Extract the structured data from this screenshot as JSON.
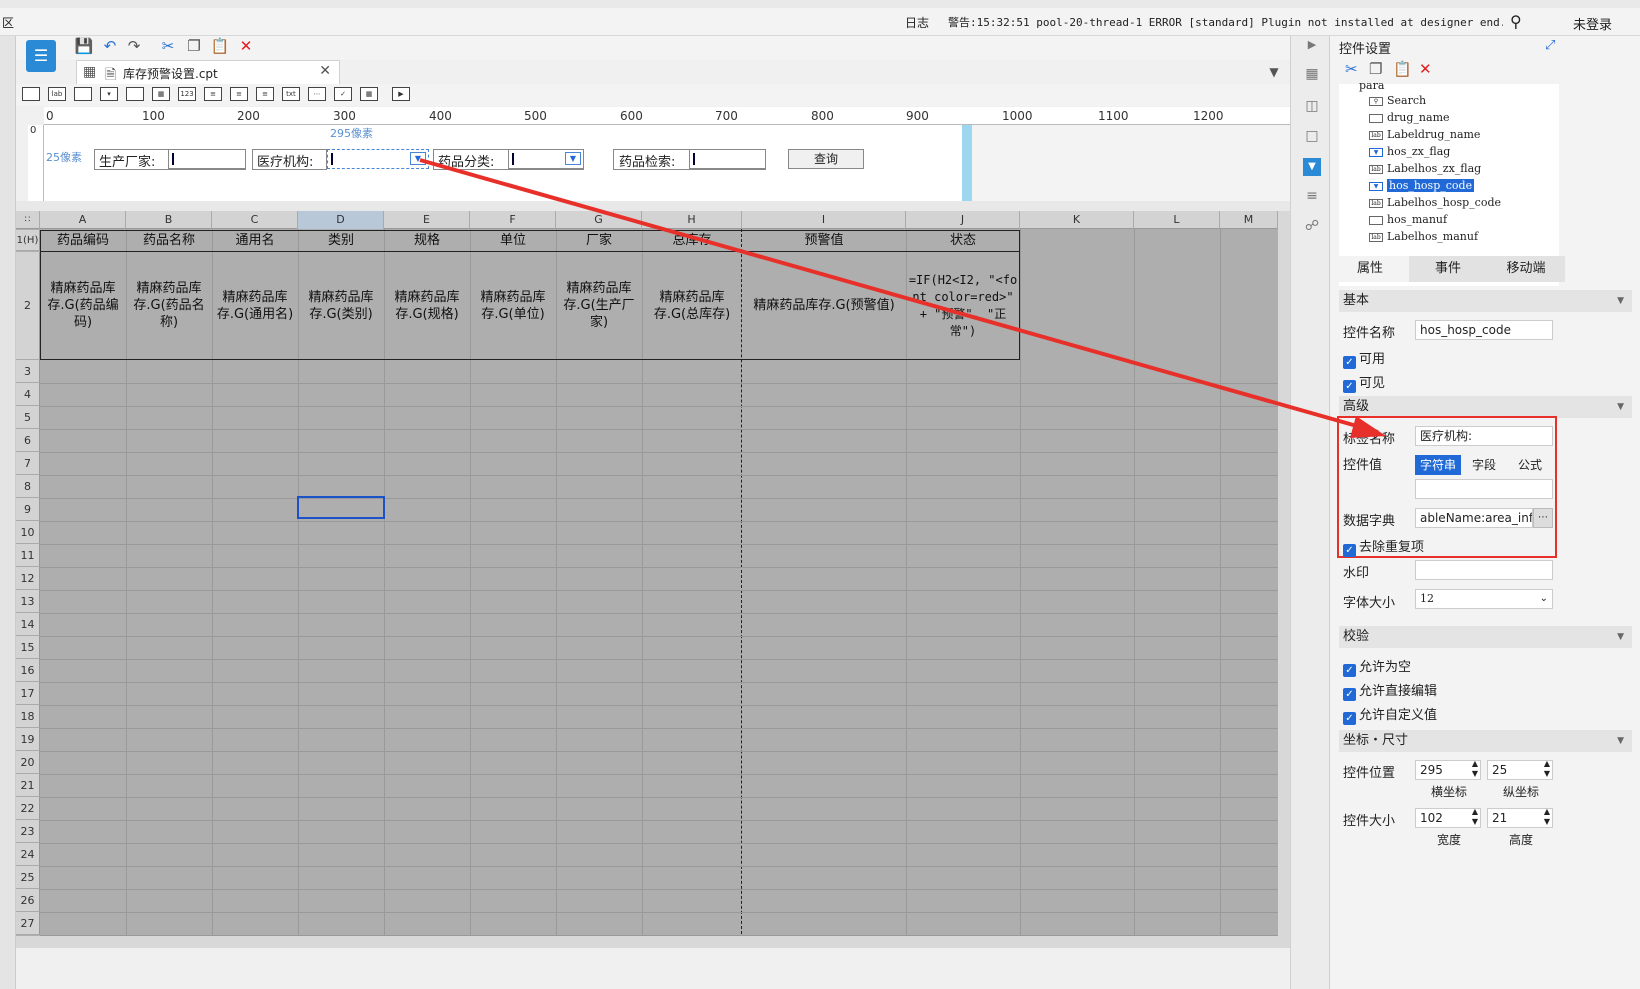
{
  "window": {
    "title_fragment": "区",
    "log_label": "日志",
    "warning": "警告:15:32:51 pool-20-thread-1 ERROR [standard] Plugin not installed at designer end.Plugi...",
    "login": "未登录"
  },
  "tab": {
    "label": "库存预警设置.cpt"
  },
  "ruler": {
    "ticks": [
      "0",
      "100",
      "200",
      "300",
      "400",
      "500",
      "600",
      "700",
      "800",
      "900",
      "1000",
      "1100",
      "1200"
    ],
    "vtick": "0"
  },
  "param": {
    "hint_x": "295像素",
    "hint_y": "25像素",
    "manufacturer_label": "生产厂家:",
    "hospital_label": "医疗机构:",
    "category_label": "药品分类:",
    "search_label": "药品检索:",
    "query_button": "查询"
  },
  "grid": {
    "columns": [
      "A",
      "B",
      "C",
      "D",
      "E",
      "F",
      "G",
      "H",
      "I",
      "J",
      "K",
      "L",
      "M"
    ],
    "row1_label": "1(H)",
    "headers": [
      "药品编码",
      "药品名称",
      "通用名",
      "类别",
      "规格",
      "单位",
      "厂家",
      "总库存",
      "预警值",
      "状态"
    ],
    "row2": [
      "精麻药品库存.G(药品编码)",
      "精麻药品库存.G(药品名称)",
      "精麻药品库存.G(通用名)",
      "精麻药品库存.G(类别)",
      "精麻药品库存.G(规格)",
      "精麻药品库存.G(单位)",
      "精麻药品库存.G(生产厂家)",
      "精麻药品库存.G(总库存)",
      "精麻药品库存.G(预警值)",
      "=IF(H2<I2, \"<font color=red>\" + \"预警\", \"正常\")"
    ],
    "row_numbers": [
      "2",
      "3",
      "4",
      "5",
      "6",
      "7",
      "8",
      "9",
      "10",
      "11",
      "12",
      "13",
      "14",
      "15",
      "16",
      "17",
      "18",
      "19",
      "20",
      "21",
      "22",
      "23",
      "24",
      "25",
      "26",
      "27"
    ]
  },
  "panel": {
    "title": "控件设置",
    "tree": {
      "root": "para",
      "items": [
        "Search",
        "drug_name",
        "Labeldrug_name",
        "hos_zx_flag",
        "Labelhos_zx_flag",
        "hos_hosp_code",
        "Labelhos_hosp_code",
        "hos_manuf",
        "Labelhos_manuf"
      ],
      "selected": "hos_hosp_code"
    },
    "tabs": [
      "属性",
      "事件",
      "移动端"
    ],
    "basic": {
      "section": "基本",
      "name_label": "控件名称",
      "name_value": "hos_hosp_code",
      "enabled": "可用",
      "visible": "可见"
    },
    "advanced": {
      "section": "高级",
      "tag_label": "标签名称",
      "tag_value": "医疗机构:",
      "value_label": "控件值",
      "value_types": [
        "字符串",
        "字段",
        "公式"
      ],
      "dict_label": "数据字典",
      "dict_value": "ableName:area_info]",
      "dedupe": "去除重复项",
      "watermark_label": "水印",
      "fontsize_label": "字体大小",
      "fontsize_value": "12"
    },
    "validation": {
      "section": "校验",
      "allow_empty": "允许为空",
      "allow_edit": "允许直接编辑",
      "allow_custom": "允许自定义值"
    },
    "coords": {
      "section": "坐标・尺寸",
      "pos_label": "控件位置",
      "x": "295",
      "y": "25",
      "x_label": "横坐标",
      "y_label": "纵坐标",
      "size_label": "控件大小",
      "w": "102",
      "h": "21",
      "w_label": "宽度",
      "h_label": "高度"
    }
  },
  "colors": {
    "accent": "#2069d6",
    "arrow": "#e8302a",
    "param_blue": "#9cd6ef"
  }
}
